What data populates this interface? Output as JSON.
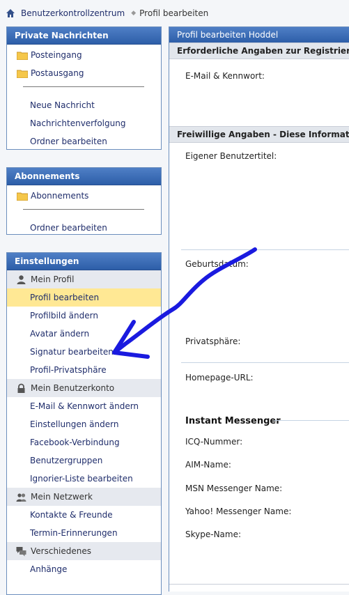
{
  "breadcrumb": {
    "home": "Benutzerkontrollzentrum",
    "current": "Profil bearbeiten"
  },
  "sidebar": {
    "private_messages": {
      "title": "Private Nachrichten",
      "folders": [
        "Posteingang",
        "Postausgang"
      ],
      "links": [
        "Neue Nachricht",
        "Nachrichtenverfolgung",
        "Ordner bearbeiten"
      ]
    },
    "subscriptions": {
      "title": "Abonnements",
      "folders": [
        "Abonnements"
      ],
      "links": [
        "Ordner bearbeiten"
      ]
    },
    "settings": {
      "title": "Einstellungen",
      "sections": [
        {
          "label": "Mein Profil",
          "icon": "user-icon",
          "items": [
            "Profil bearbeiten",
            "Profilbild ändern",
            "Avatar ändern",
            "Signatur bearbeiten",
            "Profil-Privatsphäre"
          ]
        },
        {
          "label": "Mein Benutzerkonto",
          "icon": "lock-icon",
          "items": [
            "E-Mail & Kennwort ändern",
            "Einstellungen ändern",
            "Facebook-Verbindung",
            "Benutzergruppen",
            "Ignorier-Liste bearbeiten"
          ]
        },
        {
          "label": "Mein Netzwerk",
          "icon": "users-icon",
          "items": [
            "Kontakte & Freunde",
            "Termin-Erinnerungen"
          ]
        },
        {
          "label": "Verschiedenes",
          "icon": "chat-icon",
          "items": [
            "Anhänge"
          ]
        }
      ],
      "active_item": "Profil bearbeiten"
    }
  },
  "main": {
    "title": "Profil bearbeiten Hoddel",
    "required_header": "Erforderliche Angaben zur Registrierung",
    "optional_header": "Freiwillige Angaben - Diese Informationen",
    "fields": {
      "email_password": "E-Mail & Kennwort:",
      "custom_title": "Eigener Benutzertitel:",
      "birthday": "Geburtsdatum:",
      "privacy": "Privatsphäre:",
      "homepage": "Homepage-URL:"
    },
    "im_title": "Instant Messenger",
    "im_fields": [
      "ICQ-Nummer:",
      "AIM-Name:",
      "MSN Messenger Name:",
      "Yahoo! Messenger Name:",
      "Skype-Name:"
    ]
  },
  "colors": {
    "header_blue": "#2d5ea8",
    "link": "#1f2d6b",
    "active_highlight": "#ffe894",
    "annotation_arrow": "#1a1adf"
  }
}
